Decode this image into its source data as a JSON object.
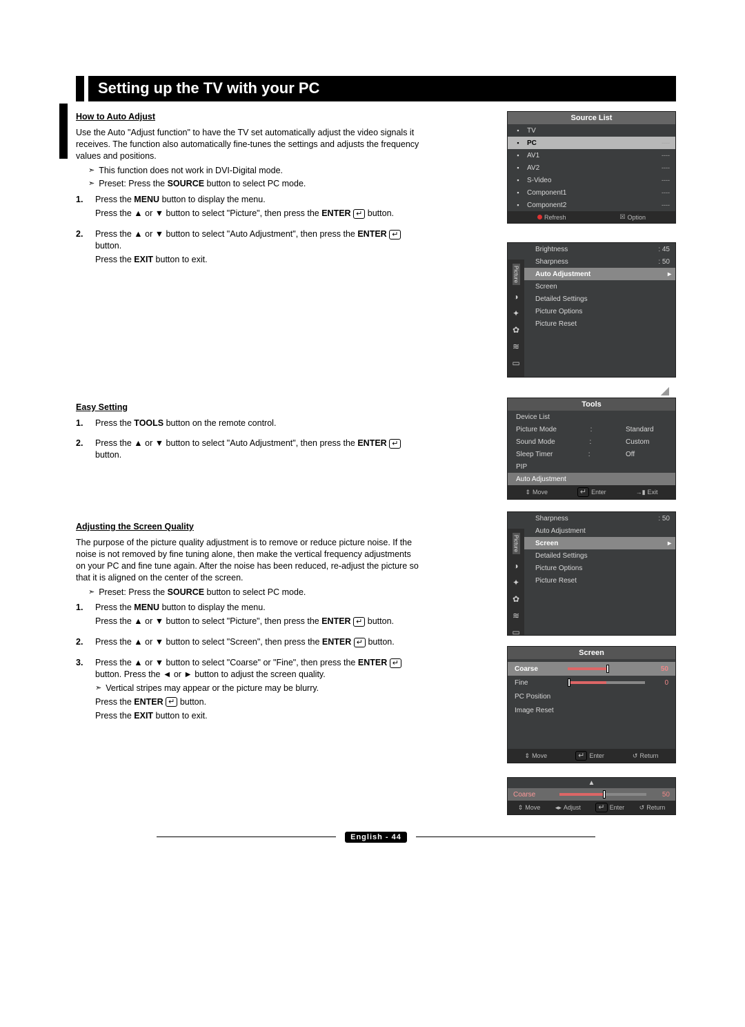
{
  "title": "Setting up the TV with your PC",
  "sec1": {
    "heading": "How to Auto Adjust",
    "intro": "Use the Auto \"Adjust function\" to have the TV set automatically adjust the video signals it receives. The function also automatically fine-tunes the settings and adjusts the frequency values and positions.",
    "note1": "This function does not work in DVI-Digital mode.",
    "note2_pre": "Preset: Press the ",
    "note2_source": "SOURCE",
    "note2_post": " button to select PC mode.",
    "step1a_pre": "Press the ",
    "step1a_menu": "MENU",
    "step1a_post": " button to display the menu.",
    "step1b_pre": "Press the ▲ or ▼ button to select \"Picture\", then press the ",
    "step1b_enter": "ENTER",
    "step1b_post": " button.",
    "step2a_pre": "Press the ▲ or ▼ button to select \"Auto Adjustment\", then press the ",
    "step2a_enter": "ENTER",
    "step2a_post": " button.",
    "step2b_pre": "Press the ",
    "step2b_exit": "EXIT",
    "step2b_post": " button to exit."
  },
  "sec2": {
    "heading": "Easy Setting",
    "step1_pre": "Press the ",
    "step1_tools": "TOOLS",
    "step1_post": " button on the remote control.",
    "step2a_pre": "Press the ▲ or ▼ button to select \"Auto Adjustment\", then press the ",
    "step2a_enter": "ENTER",
    "step2a_post": " button."
  },
  "sec3": {
    "heading": "Adjusting the Screen Quality",
    "intro": "The purpose of the picture quality adjustment is to remove or reduce picture noise. If the noise is not removed by fine tuning alone, then make the vertical frequency adjustments on your PC and fine tune again. After the noise has been reduced, re-adjust the picture so that it is aligned on the center of the screen.",
    "note1_pre": "Preset: Press the ",
    "note1_source": "SOURCE",
    "note1_post": " button to select PC mode.",
    "step1a_pre": "Press the ",
    "step1a_menu": "MENU",
    "step1a_post": " button to display the menu.",
    "step1b_pre": "Press the ▲ or ▼ button to select \"Picture\", then press the ",
    "step1b_enter": "ENTER",
    "step1b_post": " button.",
    "step2a_pre": "Press the ▲ or ▼ button to select \"Screen\", then press the ",
    "step2a_enter": "ENTER",
    "step2a_post": " button.",
    "step3a_pre": "Press the ▲ or ▼ button to select \"Coarse\" or \"Fine\", then press the ",
    "step3a_enter": "ENTER",
    "step3a_post": " button. Press the ◄ or ► button to adjust the screen quality.",
    "step3_note": "Vertical stripes may appear or the picture may be blurry.",
    "step3b_pre": "Press the ",
    "step3b_enter": "ENTER",
    "step3b_post": " button.",
    "step3c_pre": "Press the ",
    "step3c_exit": "EXIT",
    "step3c_post": " button to exit."
  },
  "osd_source": {
    "title": "Source List",
    "items": [
      {
        "label": "TV",
        "val": "",
        "sel": false
      },
      {
        "label": "PC",
        "val": "----",
        "sel": true
      },
      {
        "label": "AV1",
        "val": "----",
        "sel": false
      },
      {
        "label": "AV2",
        "val": "----",
        "sel": false
      },
      {
        "label": "S-Video",
        "val": "----",
        "sel": false
      },
      {
        "label": "Component1",
        "val": "----",
        "sel": false
      },
      {
        "label": "Component2",
        "val": "----",
        "sel": false
      }
    ],
    "footer": {
      "refresh": "Refresh",
      "option": "Option"
    }
  },
  "osd_picture": {
    "side_label": "Picture",
    "rows": [
      {
        "label": "Brightness",
        "val": ": 45",
        "hl": false
      },
      {
        "label": "Sharpness",
        "val": ": 50",
        "hl": false
      },
      {
        "label": "Auto Adjustment",
        "val": "",
        "hl": true
      },
      {
        "label": "Screen",
        "val": "",
        "hl": false
      },
      {
        "label": "Detailed Settings",
        "val": "",
        "hl": false
      },
      {
        "label": "Picture Options",
        "val": "",
        "hl": false
      },
      {
        "label": "Picture Reset",
        "val": "",
        "hl": false
      }
    ]
  },
  "osd_tools": {
    "title": "Tools",
    "rows": [
      {
        "label": "Device List",
        "val": ""
      },
      {
        "label": "Picture Mode",
        "val": "Standard"
      },
      {
        "label": "Sound Mode",
        "val": "Custom"
      },
      {
        "label": "Sleep Timer",
        "val": "Off"
      },
      {
        "label": "PIP",
        "val": ""
      },
      {
        "label": "Auto Adjustment",
        "val": "",
        "hl": true
      }
    ],
    "footer": {
      "move": "Move",
      "enter": "Enter",
      "exit": "Exit"
    }
  },
  "osd_picture2": {
    "side_label": "Picture",
    "rows": [
      {
        "label": "Sharpness",
        "val": ": 50",
        "hl": false
      },
      {
        "label": "Auto Adjustment",
        "val": "",
        "hl": false
      },
      {
        "label": "Screen",
        "val": "",
        "hl": true
      },
      {
        "label": "Detailed Settings",
        "val": "",
        "hl": false
      },
      {
        "label": "Picture Options",
        "val": "",
        "hl": false
      },
      {
        "label": "Picture Reset",
        "val": "",
        "hl": false
      }
    ]
  },
  "osd_screen": {
    "title": "Screen",
    "rows": [
      {
        "label": "Coarse",
        "val": "50",
        "hl": true,
        "pos": 50
      },
      {
        "label": "Fine",
        "val": "0",
        "hl": false,
        "pos": 0
      },
      {
        "label": "PC Position",
        "val": "",
        "hl": false
      },
      {
        "label": "Image Reset",
        "val": "",
        "hl": false
      }
    ],
    "footer": {
      "move": "Move",
      "enter": "Enter",
      "return": "Return"
    }
  },
  "osd_coarse": {
    "label": "Coarse",
    "val": "50",
    "pos": 50,
    "footer": {
      "move": "Move",
      "adjust": "Adjust",
      "enter": "Enter",
      "return": "Return"
    }
  },
  "footer": "English - 44"
}
